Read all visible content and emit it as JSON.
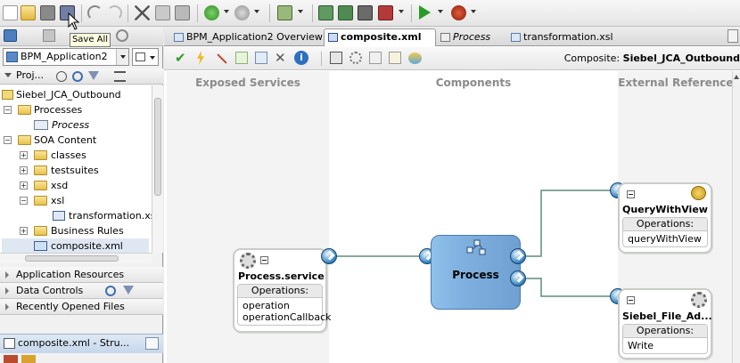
{
  "tooltip": {
    "text": "Save All"
  },
  "toolbar": {
    "icons": [
      "new-icon",
      "open-icon",
      "save-icon",
      "save-all-icon",
      "undo-icon",
      "redo-icon",
      "cut-icon",
      "copy-icon",
      "paste-icon",
      "back-icon",
      "forward-icon",
      "sql-worksheet-icon",
      "make-icon",
      "rebuild-icon",
      "deploy-icon",
      "run-icon",
      "debug-icon"
    ]
  },
  "left_panel": {
    "application_name": "BPM_Application2",
    "projects_label": "Proj...",
    "tree": [
      {
        "label": "Siebel_JCA_Outbound",
        "level": 0,
        "kind": "project"
      },
      {
        "label": "Processes",
        "level": 1,
        "kind": "folder"
      },
      {
        "label": "Process",
        "level": 2,
        "kind": "process"
      },
      {
        "label": "SOA Content",
        "level": 1,
        "kind": "folder"
      },
      {
        "label": "classes",
        "level": 2,
        "kind": "folder"
      },
      {
        "label": "testsuites",
        "level": 2,
        "kind": "folder"
      },
      {
        "label": "xsd",
        "level": 2,
        "kind": "folder"
      },
      {
        "label": "xsl",
        "level": 2,
        "kind": "folder"
      },
      {
        "label": "transformation.xsl",
        "level": 3,
        "kind": "file"
      },
      {
        "label": "Business Rules",
        "level": 2,
        "kind": "folder"
      },
      {
        "label": "composite.xml",
        "level": 2,
        "kind": "file"
      }
    ],
    "accordions": [
      "Application Resources",
      "Data Controls",
      "Recently Opened Files"
    ],
    "structure_title": "composite.xml - Stru..."
  },
  "editor": {
    "tabs": [
      {
        "label": "BPM_Application2 Overview",
        "active": false
      },
      {
        "label": "composite.xml",
        "active": true
      },
      {
        "label": "Process",
        "active": false
      },
      {
        "label": "transformation.xsl",
        "active": false
      }
    ],
    "composite_label": "Composite:",
    "composite_name": "Siebel_JCA_Outbound"
  },
  "canvas": {
    "lanes": [
      "Exposed Services",
      "Components",
      "External References"
    ],
    "service": {
      "name": "Process.service",
      "operations_label": "Operations:",
      "operations": [
        "operation",
        "operationCallback"
      ]
    },
    "component": {
      "name": "Process"
    },
    "references": [
      {
        "name": "QueryWithView",
        "operations_label": "Operations:",
        "operations": [
          "queryWithView"
        ]
      },
      {
        "name": "Siebel_File_Ad...",
        "operations_label": "Operations:",
        "operations": [
          "Write"
        ]
      }
    ]
  },
  "colors": {
    "process_fill": "#7fb0df",
    "lane_background": "#f3f3f3",
    "lane_title": "#8b8b8b",
    "wire": "#5f8b7f"
  }
}
